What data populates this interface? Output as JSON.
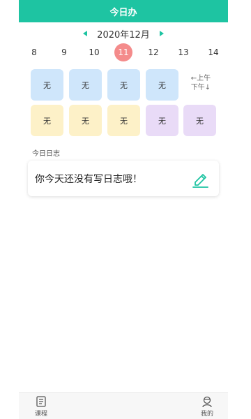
{
  "header": {
    "title": "今日办"
  },
  "calendar": {
    "month_label": "2020年12月",
    "days": [
      "8",
      "9",
      "10",
      "11",
      "12",
      "13",
      "14"
    ],
    "selected_day": "11"
  },
  "schedule": {
    "morning": [
      "无",
      "无",
      "无",
      "无"
    ],
    "afternoon": [
      "无",
      "无",
      "无",
      "无",
      "无"
    ],
    "toggle_am": "←上午",
    "toggle_pm": "下午↓",
    "colors": {
      "blue": "#cfe6fb",
      "yellow": "#fdf1c8",
      "purple": "#e9dbf7"
    }
  },
  "log": {
    "section_label": "今日日志",
    "empty_text": "你今天还没有写日志哦！",
    "icon": "pencil-edit-icon"
  },
  "tabbar": {
    "items": [
      {
        "label": "课程",
        "icon": "book-icon"
      },
      {
        "label": "我的",
        "icon": "profile-icon"
      }
    ]
  },
  "theme": {
    "accent": "#1ec4a2",
    "selected_day": "#f48b8b"
  }
}
